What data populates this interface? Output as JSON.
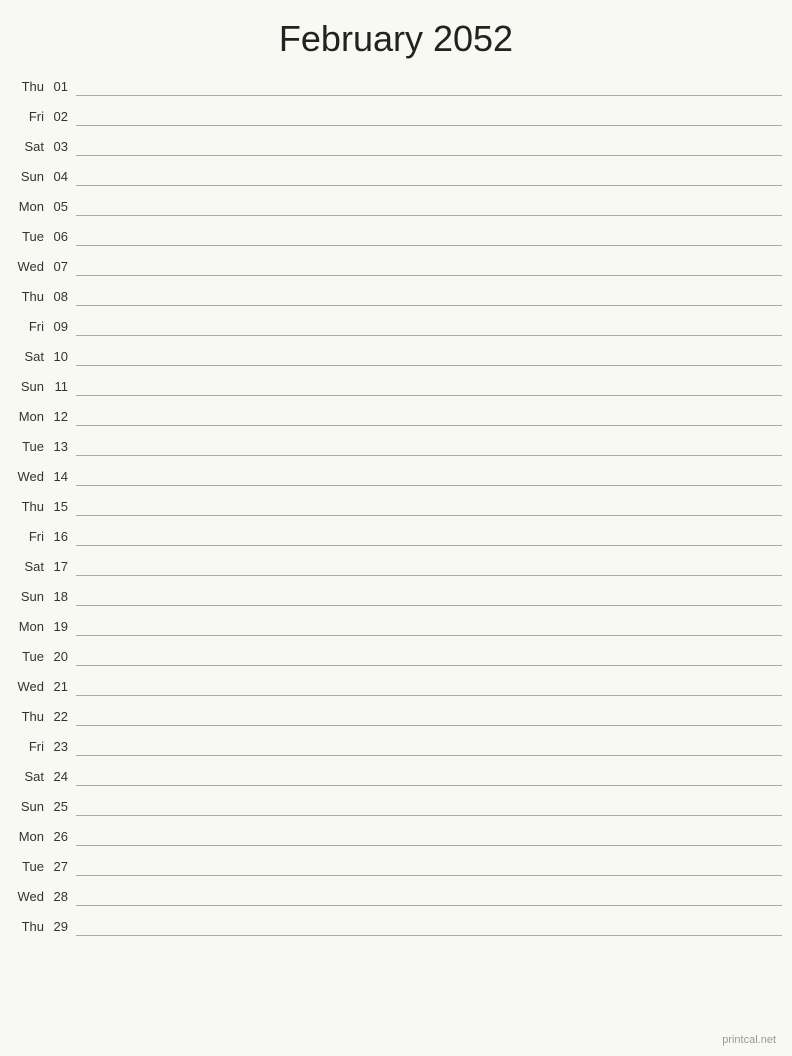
{
  "header": {
    "title": "February 2052"
  },
  "days": [
    {
      "day": "Thu",
      "date": "01"
    },
    {
      "day": "Fri",
      "date": "02"
    },
    {
      "day": "Sat",
      "date": "03"
    },
    {
      "day": "Sun",
      "date": "04"
    },
    {
      "day": "Mon",
      "date": "05"
    },
    {
      "day": "Tue",
      "date": "06"
    },
    {
      "day": "Wed",
      "date": "07"
    },
    {
      "day": "Thu",
      "date": "08"
    },
    {
      "day": "Fri",
      "date": "09"
    },
    {
      "day": "Sat",
      "date": "10"
    },
    {
      "day": "Sun",
      "date": "11"
    },
    {
      "day": "Mon",
      "date": "12"
    },
    {
      "day": "Tue",
      "date": "13"
    },
    {
      "day": "Wed",
      "date": "14"
    },
    {
      "day": "Thu",
      "date": "15"
    },
    {
      "day": "Fri",
      "date": "16"
    },
    {
      "day": "Sat",
      "date": "17"
    },
    {
      "day": "Sun",
      "date": "18"
    },
    {
      "day": "Mon",
      "date": "19"
    },
    {
      "day": "Tue",
      "date": "20"
    },
    {
      "day": "Wed",
      "date": "21"
    },
    {
      "day": "Thu",
      "date": "22"
    },
    {
      "day": "Fri",
      "date": "23"
    },
    {
      "day": "Sat",
      "date": "24"
    },
    {
      "day": "Sun",
      "date": "25"
    },
    {
      "day": "Mon",
      "date": "26"
    },
    {
      "day": "Tue",
      "date": "27"
    },
    {
      "day": "Wed",
      "date": "28"
    },
    {
      "day": "Thu",
      "date": "29"
    }
  ],
  "footer": {
    "label": "printcal.net"
  }
}
